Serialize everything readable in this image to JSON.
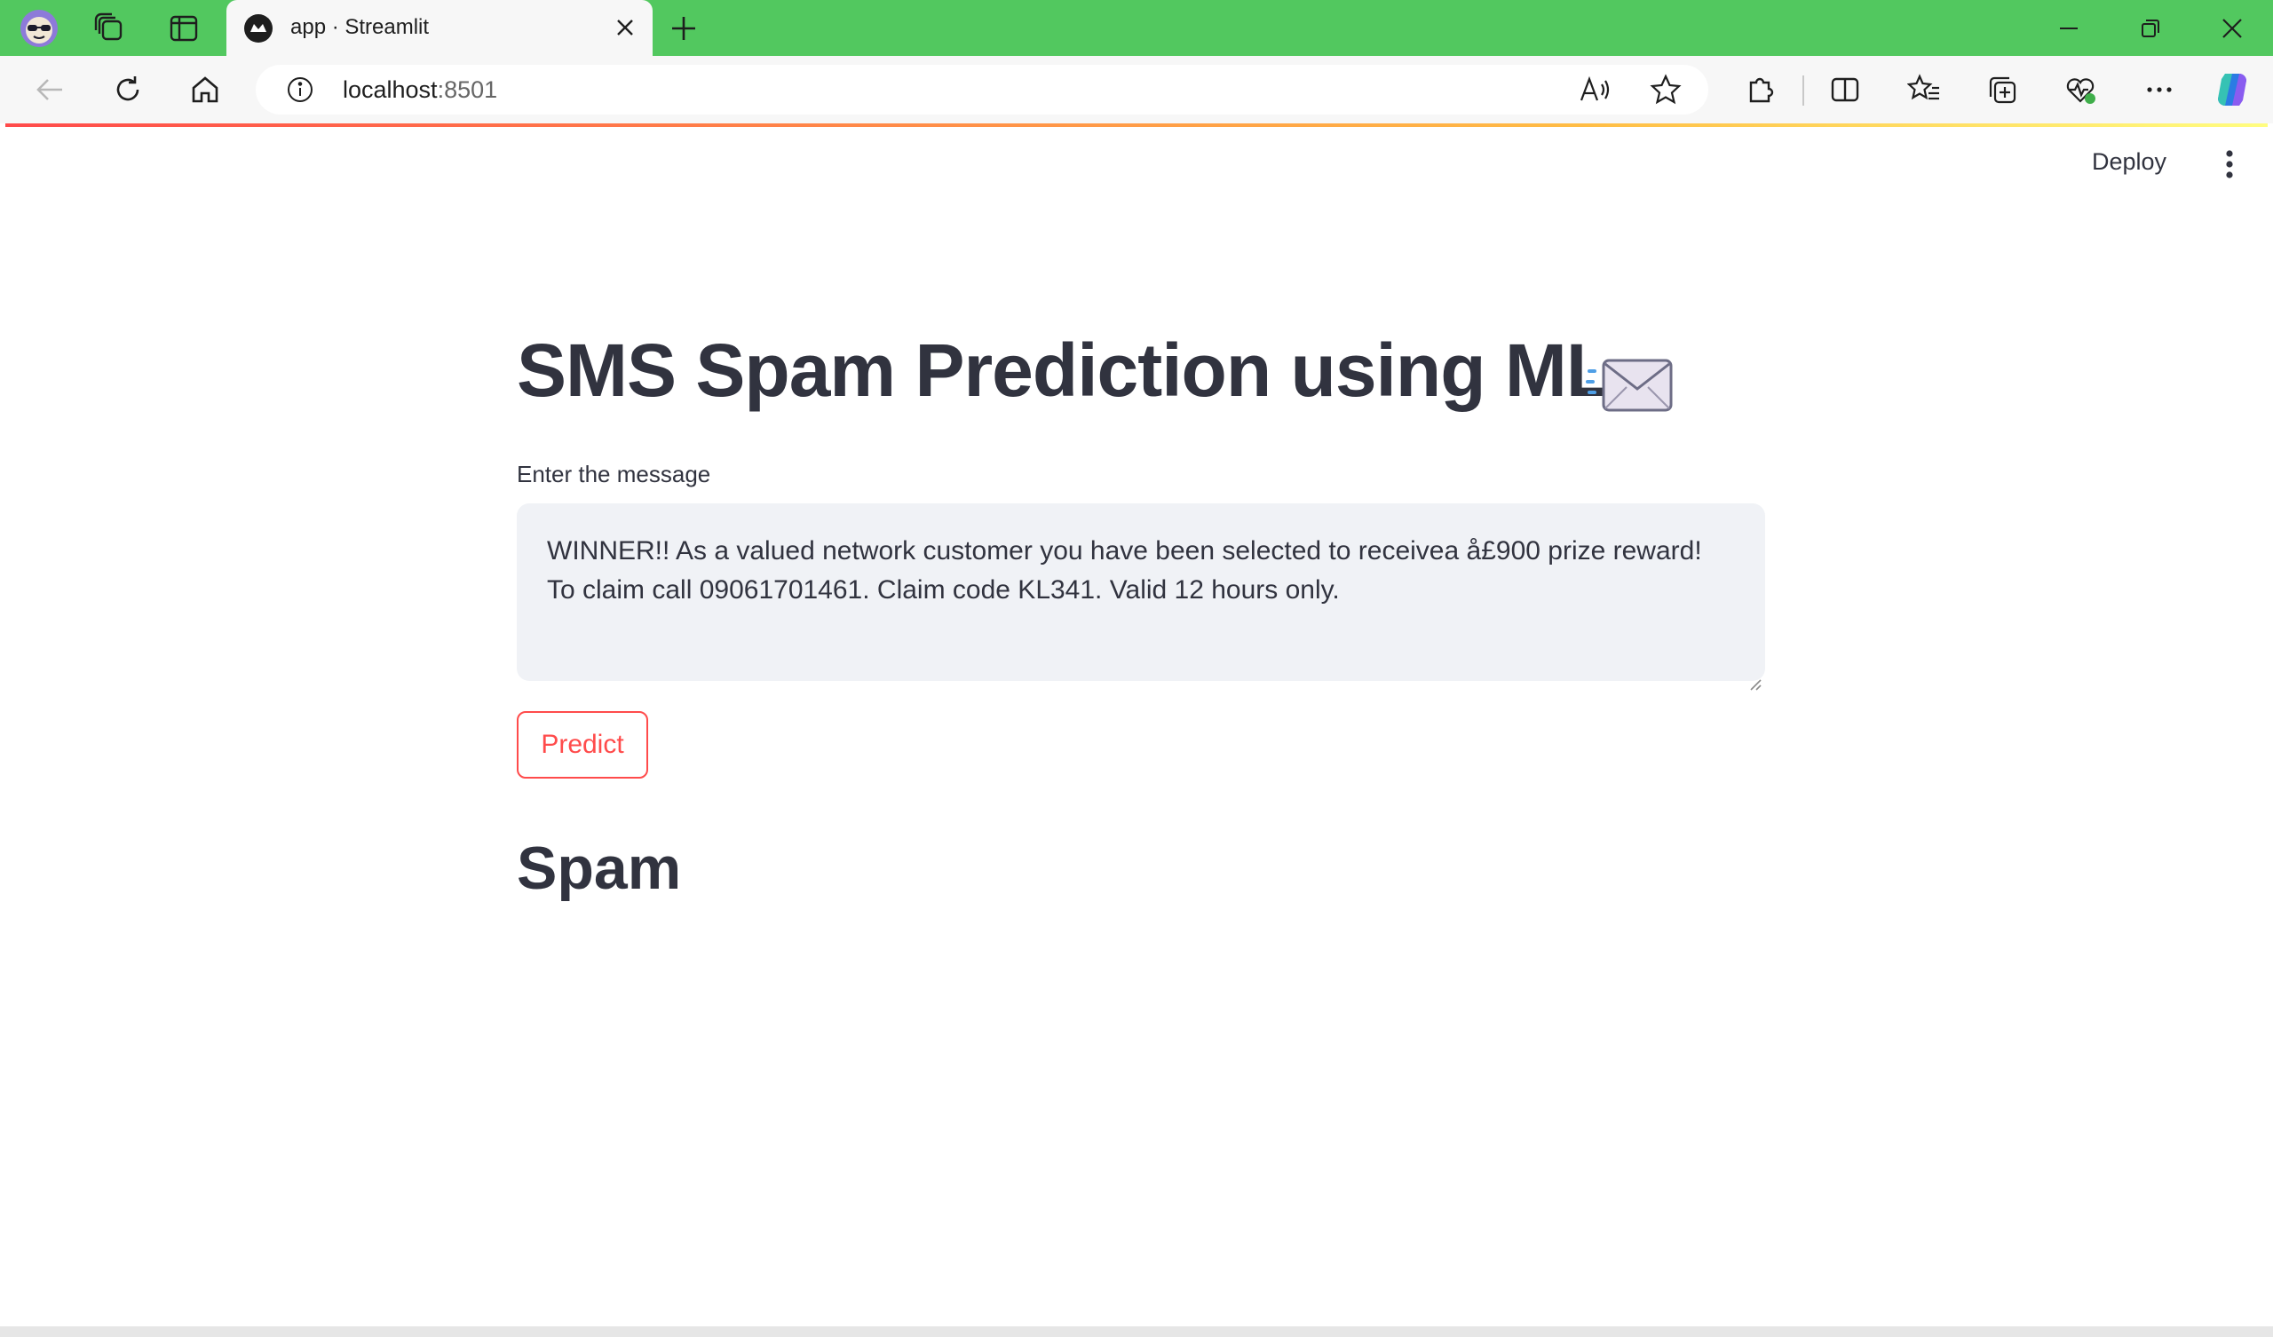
{
  "browser": {
    "tab_title": "app · Streamlit",
    "url_host": "localhost",
    "url_port": ":8501"
  },
  "header": {
    "deploy_label": "Deploy"
  },
  "main": {
    "title": "SMS Spam Prediction using ML",
    "input_label": "Enter the message",
    "message": "WINNER!! As a valued network customer you have been selected to receivea å£900 prize reward! To claim call 09061701461. Claim code KL341. Valid 12 hours only.",
    "predict_label": "Predict",
    "result": "Spam"
  },
  "colors": {
    "tabstrip": "#52c85f",
    "accent": "#ff4b4b",
    "text": "#31333f",
    "input_bg": "#f0f2f6"
  }
}
